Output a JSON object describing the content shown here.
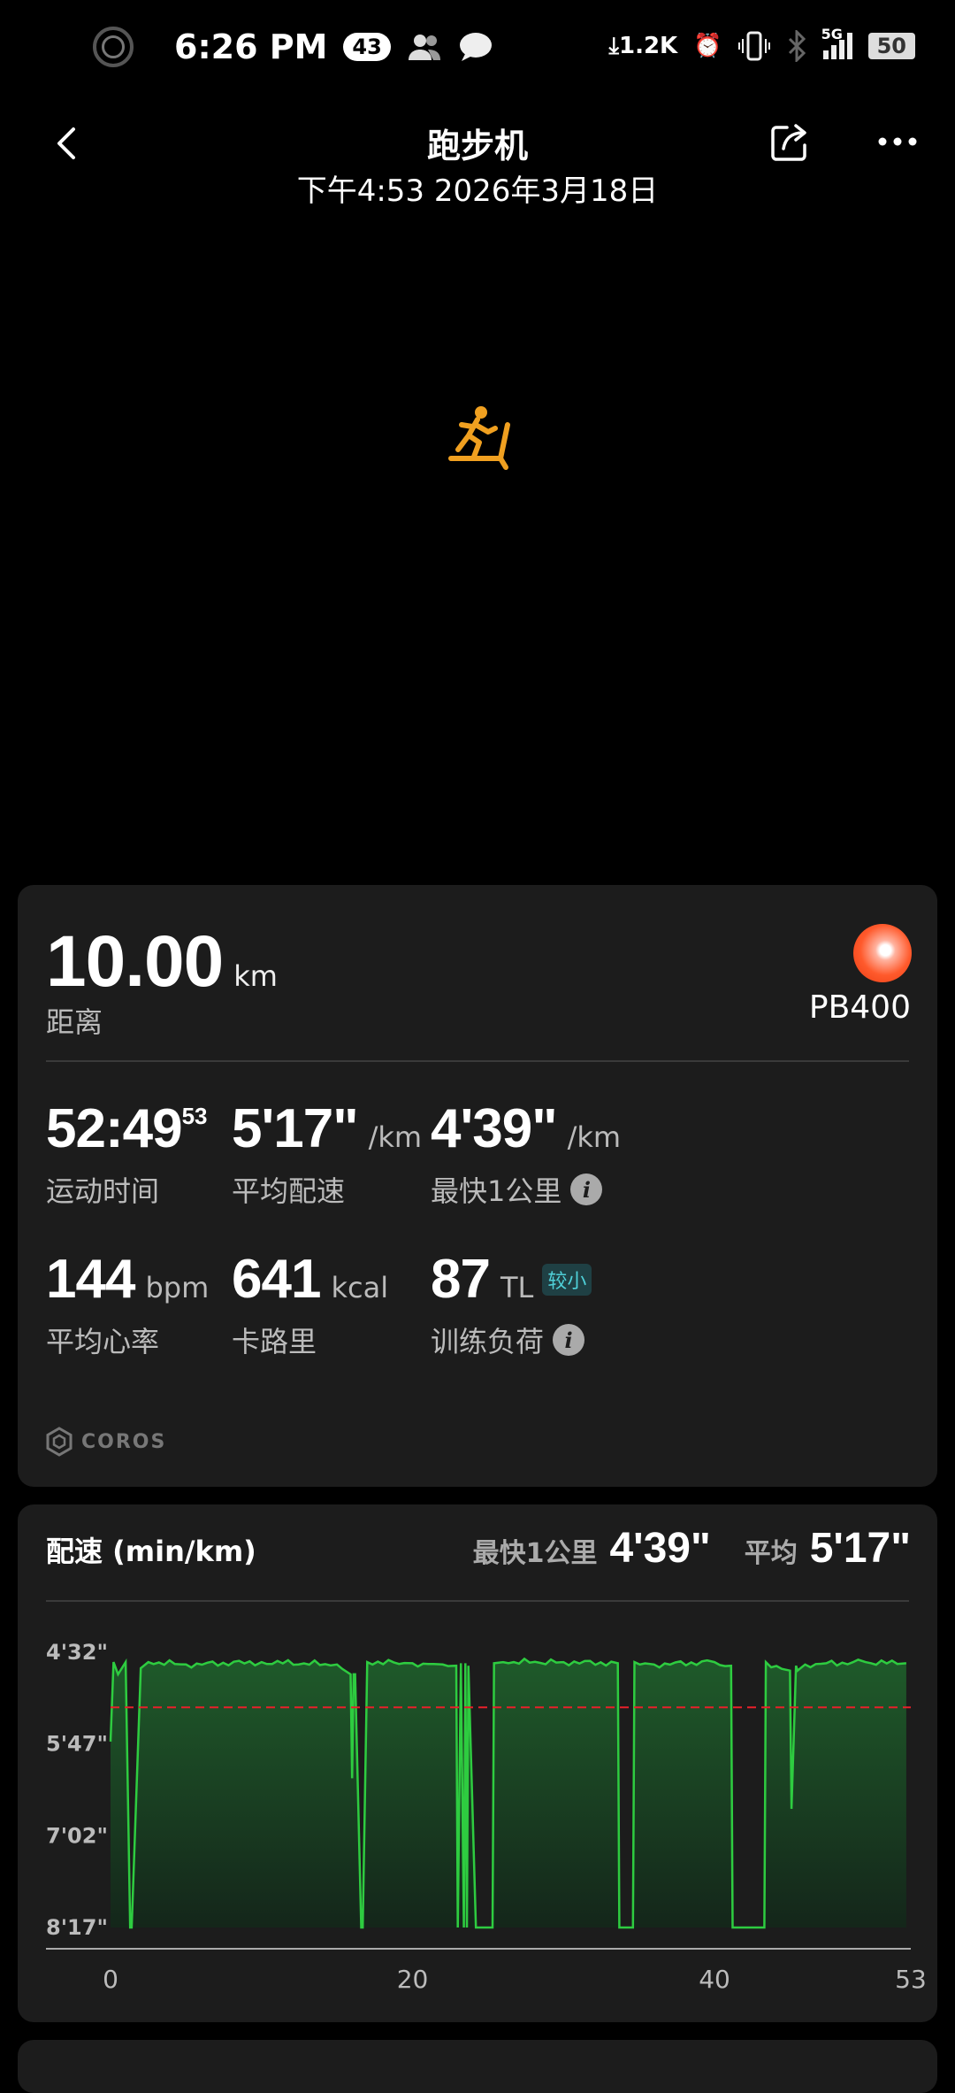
{
  "status_bar": {
    "time": "6:26 PM",
    "notif_count": "43",
    "net_speed": "1.2K",
    "network": "5G",
    "battery": "50"
  },
  "header": {
    "title": "跑步机",
    "subtitle": "下午4:53 2026年3月18日"
  },
  "summary": {
    "distance_value": "10.00",
    "distance_unit": "km",
    "distance_label": "距离",
    "pb_label": "PB400",
    "stats": [
      {
        "value": "52:49",
        "sup": "53",
        "unit": "",
        "label": "运动时间",
        "info": false,
        "tag": ""
      },
      {
        "value": "5'17\"",
        "sup": "",
        "unit": "/km",
        "label": "平均配速",
        "info": false,
        "tag": ""
      },
      {
        "value": "4'39\"",
        "sup": "",
        "unit": "/km",
        "label": "最快1公里",
        "info": true,
        "tag": ""
      },
      {
        "value": "144",
        "sup": "",
        "unit": "bpm",
        "label": "平均心率",
        "info": false,
        "tag": ""
      },
      {
        "value": "641",
        "sup": "",
        "unit": "kcal",
        "label": "卡路里",
        "info": false,
        "tag": ""
      },
      {
        "value": "87",
        "sup": "",
        "unit": "TL",
        "label": "训练负荷",
        "info": true,
        "tag": "较小"
      }
    ],
    "brand": "COROS"
  },
  "pace_chart": {
    "title": "配速 (min/km)",
    "fastest_label": "最快1公里",
    "fastest_value": "4'39\"",
    "avg_label": "平均",
    "avg_value": "5'17\""
  },
  "chart_data": {
    "type": "area",
    "title": "配速 (min/km)",
    "xlabel": "",
    "ylabel": "",
    "x_ticks": [
      "0",
      "20",
      "40",
      "53"
    ],
    "y_ticks": [
      "4'32\"",
      "5'47\"",
      "7'02\"",
      "8'17\""
    ],
    "y_tick_values_sec": [
      272,
      347,
      422,
      497
    ],
    "xlim": [
      0,
      53
    ],
    "ylim_sec": [
      272,
      497
    ],
    "y_inverted": true,
    "average_line_sec": 317,
    "series": [
      {
        "x": [
          0,
          0.2,
          0.5,
          1.0,
          1.3,
          1.4,
          2.0,
          2.5,
          5,
          10,
          15,
          15.9,
          16.0,
          16.1,
          16.2,
          16.6,
          16.7,
          17.0,
          20,
          22,
          22.9,
          23.0,
          23.2,
          23.4,
          23.5,
          23.6,
          23.7,
          24.2,
          24.4,
          25.3,
          25.4,
          26,
          30,
          33.6,
          33.7,
          34.6,
          34.7,
          36,
          40,
          41.1,
          41.2,
          43.3,
          43.4,
          45,
          45.1,
          45.4,
          45.5,
          46,
          50,
          52.7
        ],
        "pace_sec": [
          345,
          280,
          290,
          280,
          497,
          497,
          285,
          280,
          282,
          280,
          282,
          290,
          375,
          290,
          290,
          497,
          497,
          280,
          281,
          282,
          283,
          497,
          281,
          497,
          281,
          497,
          283,
          497,
          497,
          497,
          281,
          280,
          280,
          281,
          497,
          497,
          280,
          282,
          280,
          283,
          497,
          497,
          280,
          287,
          400,
          283,
          287,
          282,
          280,
          281
        ]
      }
    ],
    "colors": {
      "line": "#2ecc40",
      "average": "#e8202a"
    }
  },
  "colors": {
    "accent_orange": "#f0a030",
    "deep_orange": "#c04010",
    "card_bg": "#1c1c1c"
  },
  "icons": [
    "back-icon",
    "share-icon",
    "more-icon",
    "treadmill-icon",
    "info-icon",
    "pb-medal-icon"
  ]
}
